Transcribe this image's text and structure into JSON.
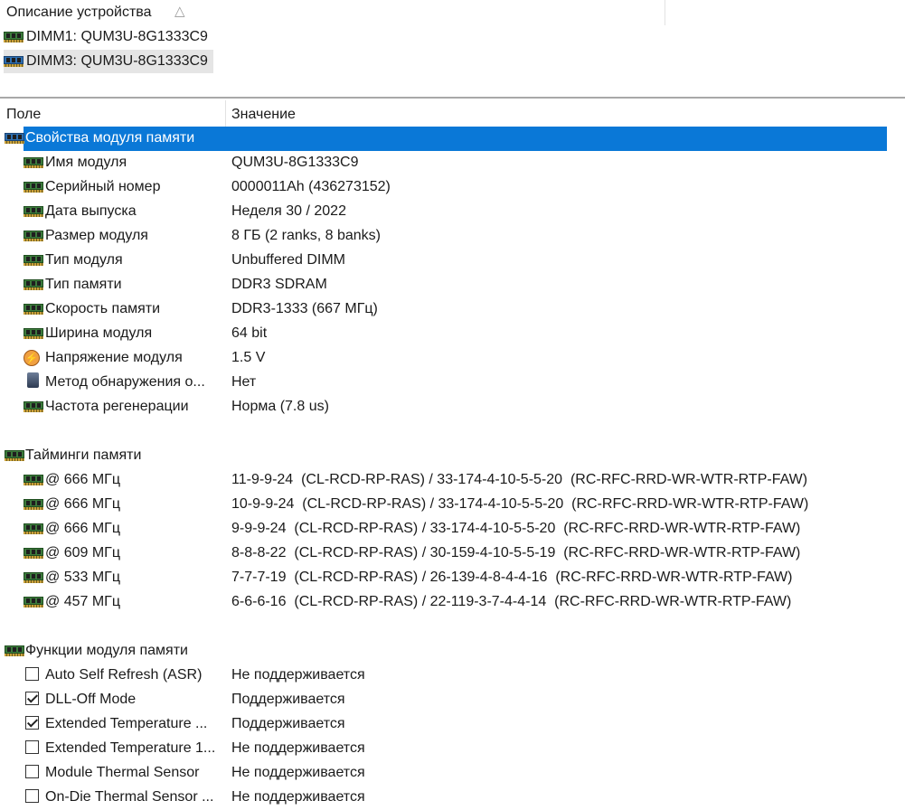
{
  "device_list": {
    "column_title": "Описание устройства",
    "sort_icon": "sort-ascending-icon",
    "items": [
      {
        "label": "DIMM1: QUM3U-8G1333C9",
        "icon": "ram-module-icon"
      },
      {
        "label": "DIMM3: QUM3U-8G1333C9",
        "icon": "ram-module-icon"
      }
    ]
  },
  "grid": {
    "headers": {
      "field": "Поле",
      "value": "Значение"
    },
    "groups": [
      {
        "title": "Свойства модуля памяти",
        "selected": true,
        "rows": [
          {
            "field": "Имя модуля",
            "value": "QUM3U-8G1333C9",
            "icon": "ram-module-icon"
          },
          {
            "field": "Серийный номер",
            "value": "0000011Ah (436273152)",
            "icon": "ram-module-icon"
          },
          {
            "field": "Дата выпуска",
            "value": "Неделя 30 / 2022",
            "icon": "ram-module-icon"
          },
          {
            "field": "Размер модуля",
            "value": "8 ГБ (2 ranks, 8 banks)",
            "icon": "ram-module-icon"
          },
          {
            "field": "Тип модуля",
            "value": "Unbuffered DIMM",
            "icon": "ram-module-icon"
          },
          {
            "field": "Тип памяти",
            "value": "DDR3 SDRAM",
            "icon": "ram-module-icon"
          },
          {
            "field": "Скорость памяти",
            "value": "DDR3-1333 (667 МГц)",
            "icon": "ram-module-icon"
          },
          {
            "field": "Ширина модуля",
            "value": "64 bit",
            "icon": "ram-module-icon"
          },
          {
            "field": "Напряжение модуля",
            "value": "1.5 V",
            "icon": "voltage-icon"
          },
          {
            "field": "Метод обнаружения о...",
            "value": "Нет",
            "icon": "chip-icon"
          },
          {
            "field": "Частота регенерации",
            "value": "Норма (7.8 us)",
            "icon": "ram-module-icon"
          }
        ]
      },
      {
        "title": "Тайминги памяти",
        "rows": [
          {
            "field": "@ 666 МГц",
            "value": "11-9-9-24  (CL-RCD-RP-RAS) / 33-174-4-10-5-5-20  (RC-RFC-RRD-WR-WTR-RTP-FAW)",
            "icon": "ram-module-icon"
          },
          {
            "field": "@ 666 МГц",
            "value": "10-9-9-24  (CL-RCD-RP-RAS) / 33-174-4-10-5-5-20  (RC-RFC-RRD-WR-WTR-RTP-FAW)",
            "icon": "ram-module-icon"
          },
          {
            "field": "@ 666 МГц",
            "value": "9-9-9-24  (CL-RCD-RP-RAS) / 33-174-4-10-5-5-20  (RC-RFC-RRD-WR-WTR-RTP-FAW)",
            "icon": "ram-module-icon"
          },
          {
            "field": "@ 609 МГц",
            "value": "8-8-8-22  (CL-RCD-RP-RAS) / 30-159-4-10-5-5-19  (RC-RFC-RRD-WR-WTR-RTP-FAW)",
            "icon": "ram-module-icon"
          },
          {
            "field": "@ 533 МГц",
            "value": "7-7-7-19  (CL-RCD-RP-RAS) / 26-139-4-8-4-4-16  (RC-RFC-RRD-WR-WTR-RTP-FAW)",
            "icon": "ram-module-icon"
          },
          {
            "field": "@ 457 МГц",
            "value": "6-6-6-16  (CL-RCD-RP-RAS) / 22-119-3-7-4-4-14  (RC-RFC-RRD-WR-WTR-RTP-FAW)",
            "icon": "ram-module-icon"
          }
        ]
      },
      {
        "title": "Функции модуля памяти",
        "rows": [
          {
            "field": "Auto Self Refresh (ASR)",
            "value": "Не поддерживается",
            "checked": false
          },
          {
            "field": "DLL-Off Mode",
            "value": "Поддерживается",
            "checked": true
          },
          {
            "field": "Extended Temperature ...",
            "value": "Поддерживается",
            "checked": true
          },
          {
            "field": "Extended Temperature 1...",
            "value": "Не поддерживается",
            "checked": false
          },
          {
            "field": "Module Thermal Sensor",
            "value": "Не поддерживается",
            "checked": false
          },
          {
            "field": "On-Die Thermal Sensor ...",
            "value": "Не поддерживается",
            "checked": false
          }
        ]
      }
    ]
  },
  "colors": {
    "selection": "#0a78d7",
    "selected_device_bg": "#e5e5e5"
  }
}
